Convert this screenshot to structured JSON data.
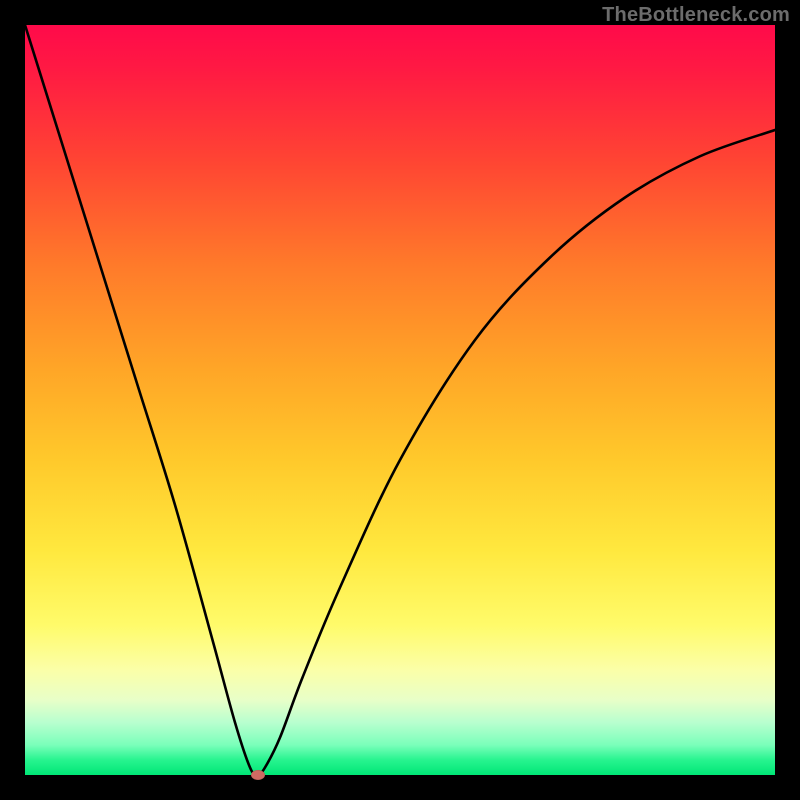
{
  "watermark": "TheBottleneck.com",
  "colors": {
    "frame": "#000000",
    "curve": "#000000",
    "marker": "#cf6a62"
  },
  "chart_data": {
    "type": "line",
    "title": "",
    "xlabel": "",
    "ylabel": "",
    "xlim": [
      0,
      100
    ],
    "ylim": [
      0,
      100
    ],
    "grid": false,
    "series": [
      {
        "name": "bottleneck-curve",
        "x": [
          0,
          5,
          10,
          15,
          20,
          25,
          28,
          30,
          31,
          32,
          34,
          37,
          42,
          50,
          60,
          70,
          80,
          90,
          100
        ],
        "y": [
          100,
          84,
          68,
          52,
          36,
          18,
          7,
          1,
          0,
          1,
          5,
          13,
          25,
          42,
          58,
          69,
          77,
          82.5,
          86
        ]
      }
    ],
    "marker": {
      "x": 31,
      "y": 0
    },
    "background_gradient": {
      "direction": "top-to-bottom",
      "stops": [
        {
          "pos": 0.0,
          "color": "#ff0a4a"
        },
        {
          "pos": 0.5,
          "color": "#ffb92a"
        },
        {
          "pos": 0.8,
          "color": "#fffb6a"
        },
        {
          "pos": 1.0,
          "color": "#00e676"
        }
      ]
    }
  }
}
